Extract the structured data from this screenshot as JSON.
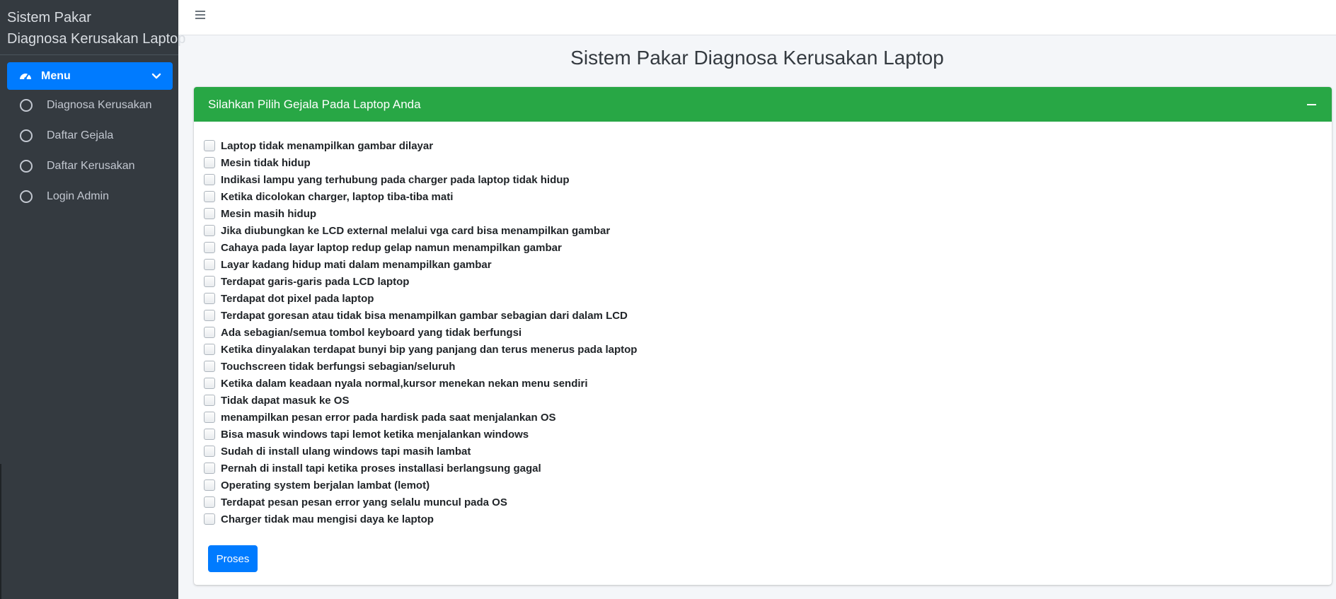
{
  "app": {
    "brand_line1": "Sistem Pakar",
    "brand_line2": "Diagnosa Kerusakan Laptop"
  },
  "sidebar": {
    "menu_label": "Menu",
    "items": [
      {
        "label": "Diagnosa Kerusakan"
      },
      {
        "label": "Daftar Gejala"
      },
      {
        "label": "Daftar Kerusakan"
      },
      {
        "label": "Login Admin"
      }
    ]
  },
  "header": {
    "page_title": "Sistem Pakar Diagnosa Kerusakan Laptop"
  },
  "card": {
    "title": "Silahkan Pilih Gejala Pada Laptop Anda",
    "symptoms": [
      {
        "label": "Laptop tidak menampilkan gambar dilayar",
        "checked": false
      },
      {
        "label": "Mesin tidak hidup",
        "checked": false
      },
      {
        "label": "Indikasi lampu yang terhubung pada charger pada laptop tidak hidup",
        "checked": false
      },
      {
        "label": "Ketika dicolokan charger, laptop tiba-tiba mati",
        "checked": false
      },
      {
        "label": "Mesin masih hidup",
        "checked": false
      },
      {
        "label": "Jika diubungkan ke LCD external melalui vga card bisa menampilkan gambar",
        "checked": false
      },
      {
        "label": "Cahaya pada layar laptop redup gelap namun menampilkan gambar",
        "checked": false
      },
      {
        "label": "Layar kadang hidup mati dalam menampilkan gambar",
        "checked": false
      },
      {
        "label": "Terdapat garis-garis pada LCD laptop",
        "checked": false
      },
      {
        "label": "Terdapat dot pixel pada laptop",
        "checked": false
      },
      {
        "label": "Terdapat goresan atau tidak bisa menampilkan gambar sebagian dari dalam LCD",
        "checked": false
      },
      {
        "label": "Ada sebagian/semua tombol keyboard yang tidak berfungsi",
        "checked": false
      },
      {
        "label": "Ketika dinyalakan terdapat bunyi bip yang panjang dan terus menerus pada laptop",
        "checked": false
      },
      {
        "label": "Touchscreen tidak berfungsi sebagian/seluruh",
        "checked": false
      },
      {
        "label": "Ketika dalam keadaan nyala normal,kursor menekan nekan menu sendiri",
        "checked": false
      },
      {
        "label": "Tidak dapat masuk ke OS",
        "checked": false
      },
      {
        "label": "menampilkan pesan error pada hardisk pada saat menjalankan OS",
        "checked": false
      },
      {
        "label": "Bisa masuk windows tapi lemot ketika menjalankan windows",
        "checked": false
      },
      {
        "label": "Sudah di install ulang windows tapi masih lambat",
        "checked": false
      },
      {
        "label": "Pernah di install tapi ketika proses installasi berlangsung gagal",
        "checked": false
      },
      {
        "label": "Operating system berjalan lambat (lemot)",
        "checked": false
      },
      {
        "label": "Terdapat pesan pesan error yang selalu muncul pada OS",
        "checked": false
      },
      {
        "label": "Charger tidak mau mengisi daya ke laptop",
        "checked": false
      }
    ],
    "submit_label": "Proses"
  },
  "icons": {
    "menu_icon": "tachometer-icon",
    "chevron": "chevron-down-icon",
    "nav_item_icon": "circle-outline-icon",
    "toggle_icon": "hamburger-icon",
    "collapse_icon": "minus-icon"
  },
  "colors": {
    "sidebar_bg": "#343a40",
    "primary": "#007bff",
    "card_header": "#28a745"
  }
}
